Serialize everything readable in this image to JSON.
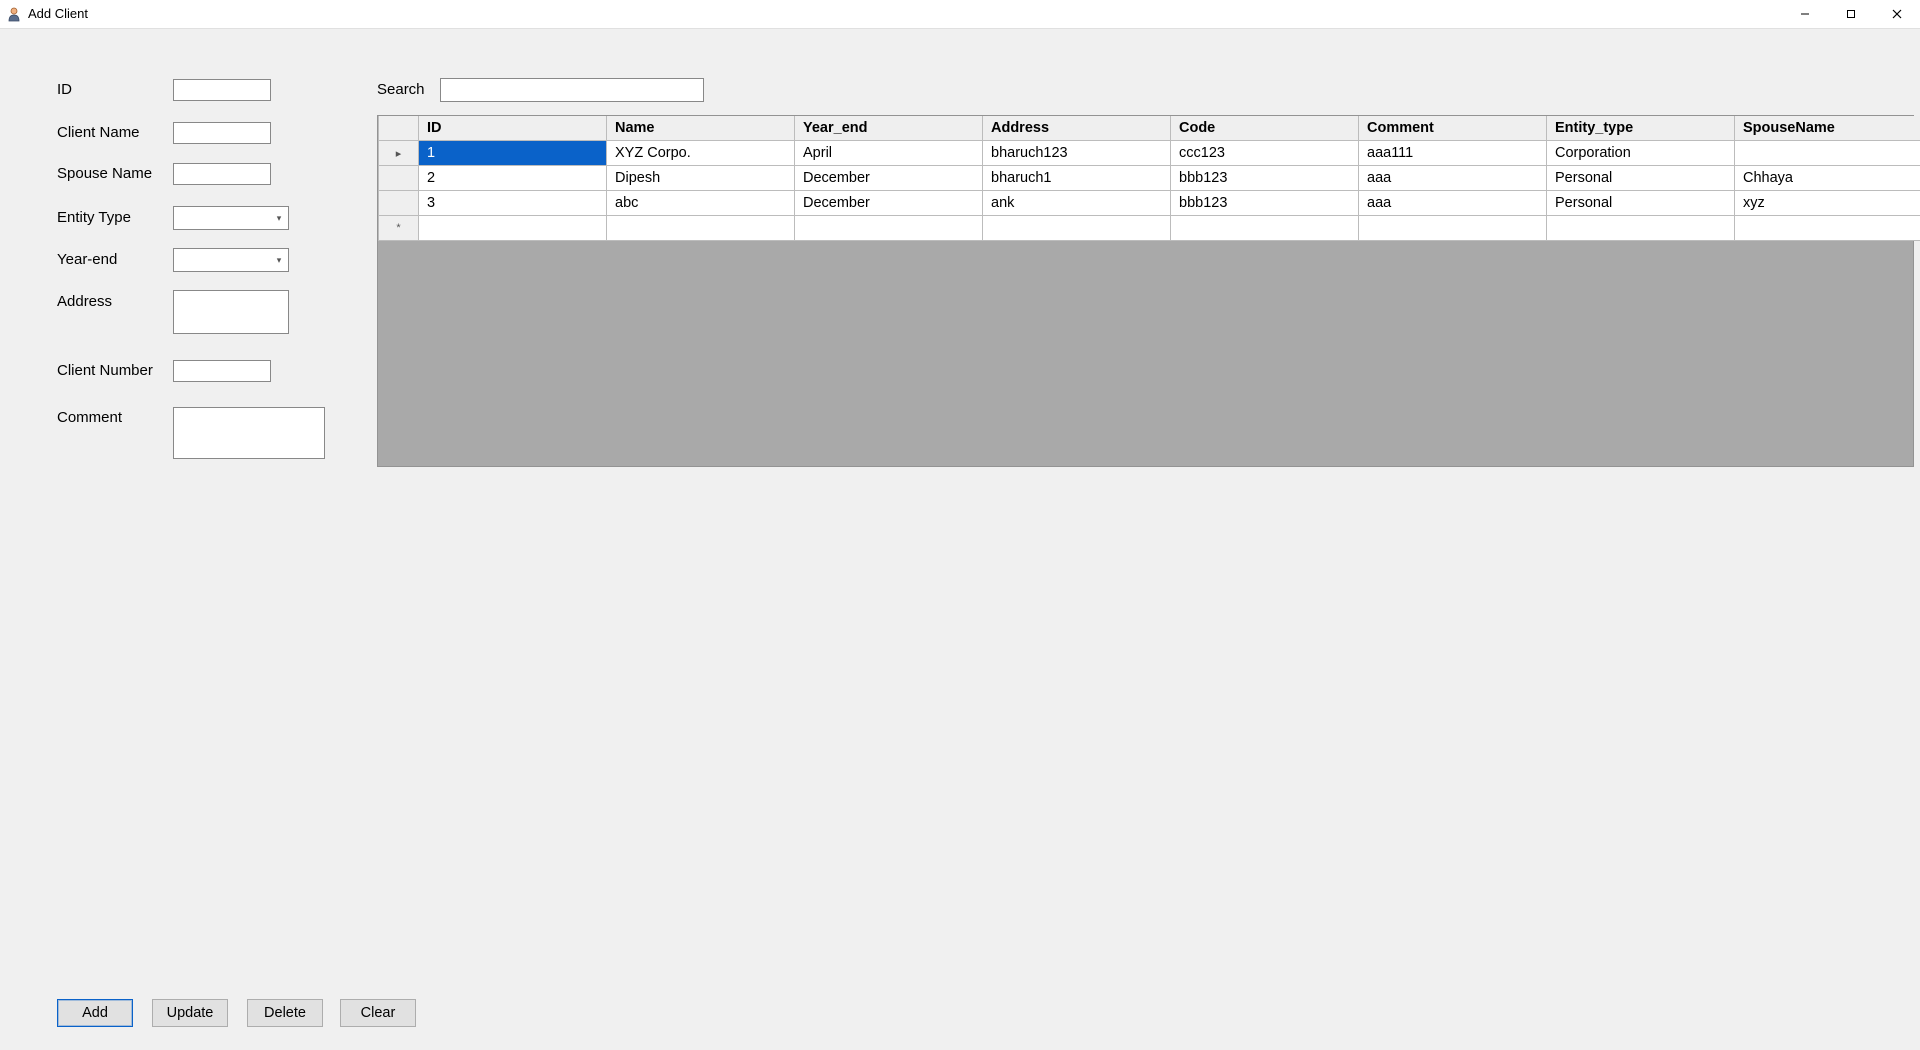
{
  "window": {
    "title": "Add Client"
  },
  "form": {
    "id_label": "ID",
    "id_value": "",
    "client_name_label": "Client Name",
    "client_name_value": "",
    "spouse_name_label": "Spouse Name",
    "spouse_name_value": "",
    "entity_type_label": "Entity Type",
    "entity_type_value": "",
    "year_end_label": "Year-end",
    "year_end_value": "",
    "address_label": "Address",
    "address_value": "",
    "client_number_label": "Client Number",
    "client_number_value": "",
    "comment_label": "Comment",
    "comment_value": ""
  },
  "search": {
    "label": "Search",
    "value": ""
  },
  "grid": {
    "columns": [
      "ID",
      "Name",
      "Year_end",
      "Address",
      "Code",
      "Comment",
      "Entity_type",
      "SpouseName"
    ],
    "rows": [
      {
        "id": "1",
        "name": "XYZ Corpo.",
        "year_end": "April",
        "address": "bharuch123",
        "code": "ccc123",
        "comment": "aaa111",
        "entity_type": "Corporation",
        "spouse_name": ""
      },
      {
        "id": "2",
        "name": "Dipesh",
        "year_end": "December",
        "address": "bharuch1",
        "code": "bbb123",
        "comment": "aaa",
        "entity_type": "Personal",
        "spouse_name": "Chhaya"
      },
      {
        "id": "3",
        "name": "abc",
        "year_end": "December",
        "address": "ank",
        "code": "bbb123",
        "comment": "aaa",
        "entity_type": "Personal",
        "spouse_name": "xyz"
      }
    ],
    "selected_row": 0,
    "selected_col": "id",
    "row_indicators": {
      "current": "▸",
      "new": "*"
    }
  },
  "buttons": {
    "add": "Add",
    "update": "Update",
    "delete": "Delete",
    "clear": "Clear"
  }
}
